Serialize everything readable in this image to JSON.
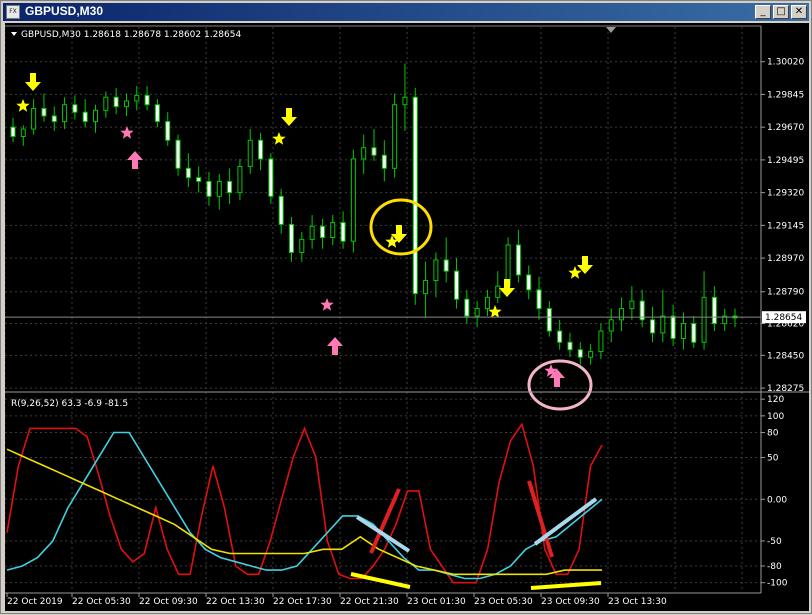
{
  "window": {
    "title": "GBPUSD,M30",
    "icon_label": "FX",
    "buttons": {
      "minimize": "_",
      "maximize": "□",
      "close": "✕"
    }
  },
  "colors": {
    "background": "#000000",
    "grid": "#3c3c3c",
    "bull_candle": "#000000",
    "bear_candle": "#ffffff",
    "candle_outline": "#00c800",
    "rsi_line": "#e01010",
    "ma_fast_line": "#40d0e0",
    "ma_slow_line": "#f0e000",
    "arrow_down": "#ffff00",
    "arrow_up": "#ff7ab5",
    "star_yellow": "#ffff00",
    "star_pink": "#ff7ab5",
    "axis_text": "#ffffff",
    "annotation_circle_yellow": "#ffdd00",
    "annotation_circle_pink": "#f5b5c8",
    "annotation_red": "#e02020",
    "annotation_blue": "#a8d8ee",
    "annotation_yellow": "#ffff00"
  },
  "chart": {
    "symbol_line": "GBPUSD,M30  1.28618 1.28678 1.28602 1.28654",
    "current_price": "1.28654",
    "price_labels": [
      "1.30020",
      "1.29845",
      "1.29670",
      "1.29495",
      "1.29320",
      "1.29145",
      "1.28970",
      "1.28790",
      "1.28620",
      "1.28450",
      "1.28275"
    ],
    "osc_header": "R(9,26,52) 63.3 -6.9 -81.5",
    "osc_labels": [
      "120",
      "100",
      "80",
      "50",
      "0.00",
      "-50",
      "-80",
      "-100"
    ],
    "time_labels": [
      "22 Oct 2019",
      "22 Oct 05:30",
      "22 Oct 09:30",
      "22 Oct 13:30",
      "22 Oct 17:30",
      "22 Oct 21:30",
      "23 Oct 01:30",
      "23 Oct 05:30",
      "23 Oct 09:30",
      "23 Oct 13:30"
    ]
  },
  "chart_data": [
    {
      "type": "candlestick",
      "title": "GBPUSD,M30  1.28618 1.28678 1.28602 1.28654",
      "ylim": [
        1.2827,
        1.3012
      ],
      "candles": [
        {
          "o": 1.2967,
          "h": 1.2972,
          "l": 1.2959,
          "c": 1.2962
        },
        {
          "o": 1.2962,
          "h": 1.2968,
          "l": 1.2957,
          "c": 1.2966
        },
        {
          "o": 1.2966,
          "h": 1.2982,
          "l": 1.2963,
          "c": 1.2977
        },
        {
          "o": 1.2977,
          "h": 1.2985,
          "l": 1.297,
          "c": 1.2973
        },
        {
          "o": 1.2973,
          "h": 1.2978,
          "l": 1.2965,
          "c": 1.297
        },
        {
          "o": 1.297,
          "h": 1.2983,
          "l": 1.2966,
          "c": 1.2979
        },
        {
          "o": 1.2979,
          "h": 1.2984,
          "l": 1.2971,
          "c": 1.2975
        },
        {
          "o": 1.2975,
          "h": 1.2982,
          "l": 1.2967,
          "c": 1.297
        },
        {
          "o": 1.297,
          "h": 1.2979,
          "l": 1.2964,
          "c": 1.2976
        },
        {
          "o": 1.2976,
          "h": 1.2986,
          "l": 1.2972,
          "c": 1.2983
        },
        {
          "o": 1.2983,
          "h": 1.2988,
          "l": 1.2974,
          "c": 1.2978
        },
        {
          "o": 1.2978,
          "h": 1.2985,
          "l": 1.2973,
          "c": 1.2981
        },
        {
          "o": 1.2981,
          "h": 1.2989,
          "l": 1.2976,
          "c": 1.2984
        },
        {
          "o": 1.2984,
          "h": 1.2989,
          "l": 1.2976,
          "c": 1.2979
        },
        {
          "o": 1.2979,
          "h": 1.2982,
          "l": 1.2967,
          "c": 1.297
        },
        {
          "o": 1.297,
          "h": 1.2975,
          "l": 1.2957,
          "c": 1.296
        },
        {
          "o": 1.296,
          "h": 1.2963,
          "l": 1.2941,
          "c": 1.2945
        },
        {
          "o": 1.2945,
          "h": 1.2953,
          "l": 1.2935,
          "c": 1.294
        },
        {
          "o": 1.294,
          "h": 1.2946,
          "l": 1.2932,
          "c": 1.2938
        },
        {
          "o": 1.2938,
          "h": 1.2943,
          "l": 1.2925,
          "c": 1.293
        },
        {
          "o": 1.293,
          "h": 1.2942,
          "l": 1.2923,
          "c": 1.2938
        },
        {
          "o": 1.2938,
          "h": 1.2945,
          "l": 1.2926,
          "c": 1.2932
        },
        {
          "o": 1.2932,
          "h": 1.295,
          "l": 1.2928,
          "c": 1.2946
        },
        {
          "o": 1.2946,
          "h": 1.2966,
          "l": 1.2942,
          "c": 1.296
        },
        {
          "o": 1.296,
          "h": 1.2964,
          "l": 1.2944,
          "c": 1.295
        },
        {
          "o": 1.295,
          "h": 1.2953,
          "l": 1.2926,
          "c": 1.293
        },
        {
          "o": 1.293,
          "h": 1.2934,
          "l": 1.291,
          "c": 1.2915
        },
        {
          "o": 1.2915,
          "h": 1.2919,
          "l": 1.2895,
          "c": 1.29
        },
        {
          "o": 1.29,
          "h": 1.2911,
          "l": 1.2895,
          "c": 1.2907
        },
        {
          "o": 1.2907,
          "h": 1.292,
          "l": 1.2902,
          "c": 1.2914
        },
        {
          "o": 1.2914,
          "h": 1.2918,
          "l": 1.2902,
          "c": 1.2908
        },
        {
          "o": 1.2908,
          "h": 1.292,
          "l": 1.2904,
          "c": 1.2916
        },
        {
          "o": 1.2916,
          "h": 1.2922,
          "l": 1.2902,
          "c": 1.2906
        },
        {
          "o": 1.2906,
          "h": 1.2955,
          "l": 1.29,
          "c": 1.295
        },
        {
          "o": 1.295,
          "h": 1.2963,
          "l": 1.2942,
          "c": 1.2956
        },
        {
          "o": 1.2956,
          "h": 1.2966,
          "l": 1.2949,
          "c": 1.2952
        },
        {
          "o": 1.2952,
          "h": 1.296,
          "l": 1.2938,
          "c": 1.2945
        },
        {
          "o": 1.2945,
          "h": 1.2985,
          "l": 1.294,
          "c": 1.2979
        },
        {
          "o": 1.2979,
          "h": 1.3001,
          "l": 1.2965,
          "c": 1.2983
        },
        {
          "o": 1.2983,
          "h": 1.2988,
          "l": 1.2872,
          "c": 1.2878
        },
        {
          "o": 1.2878,
          "h": 1.2895,
          "l": 1.2865,
          "c": 1.2885
        },
        {
          "o": 1.2885,
          "h": 1.29,
          "l": 1.2876,
          "c": 1.2896
        },
        {
          "o": 1.2896,
          "h": 1.2908,
          "l": 1.2884,
          "c": 1.289
        },
        {
          "o": 1.289,
          "h": 1.2897,
          "l": 1.287,
          "c": 1.2875
        },
        {
          "o": 1.2875,
          "h": 1.288,
          "l": 1.2862,
          "c": 1.2866
        },
        {
          "o": 1.2866,
          "h": 1.2874,
          "l": 1.286,
          "c": 1.287
        },
        {
          "o": 1.287,
          "h": 1.288,
          "l": 1.2866,
          "c": 1.2876
        },
        {
          "o": 1.2876,
          "h": 1.289,
          "l": 1.2873,
          "c": 1.2882
        },
        {
          "o": 1.2882,
          "h": 1.2908,
          "l": 1.2879,
          "c": 1.2904
        },
        {
          "o": 1.2904,
          "h": 1.2912,
          "l": 1.2884,
          "c": 1.2888
        },
        {
          "o": 1.2888,
          "h": 1.2893,
          "l": 1.2875,
          "c": 1.288
        },
        {
          "o": 1.288,
          "h": 1.2887,
          "l": 1.2864,
          "c": 1.287
        },
        {
          "o": 1.287,
          "h": 1.2874,
          "l": 1.2855,
          "c": 1.2858
        },
        {
          "o": 1.2858,
          "h": 1.2864,
          "l": 1.2848,
          "c": 1.2852
        },
        {
          "o": 1.2852,
          "h": 1.2857,
          "l": 1.2844,
          "c": 1.2848
        },
        {
          "o": 1.2848,
          "h": 1.2852,
          "l": 1.284,
          "c": 1.2844
        },
        {
          "o": 1.2844,
          "h": 1.2851,
          "l": 1.284,
          "c": 1.2847
        },
        {
          "o": 1.2847,
          "h": 1.2862,
          "l": 1.2843,
          "c": 1.2858
        },
        {
          "o": 1.2858,
          "h": 1.287,
          "l": 1.2852,
          "c": 1.2864
        },
        {
          "o": 1.2864,
          "h": 1.2876,
          "l": 1.2858,
          "c": 1.287
        },
        {
          "o": 1.287,
          "h": 1.2882,
          "l": 1.2864,
          "c": 1.2874
        },
        {
          "o": 1.2874,
          "h": 1.288,
          "l": 1.286,
          "c": 1.2864
        },
        {
          "o": 1.2864,
          "h": 1.2871,
          "l": 1.2852,
          "c": 1.2857
        },
        {
          "o": 1.2857,
          "h": 1.288,
          "l": 1.2852,
          "c": 1.2866
        },
        {
          "o": 1.2866,
          "h": 1.2872,
          "l": 1.285,
          "c": 1.2854
        },
        {
          "o": 1.2854,
          "h": 1.2868,
          "l": 1.2848,
          "c": 1.2862
        },
        {
          "o": 1.2862,
          "h": 1.2866,
          "l": 1.2849,
          "c": 1.2852
        },
        {
          "o": 1.2852,
          "h": 1.289,
          "l": 1.2848,
          "c": 1.2876
        },
        {
          "o": 1.2876,
          "h": 1.2882,
          "l": 1.2858,
          "c": 1.2862
        },
        {
          "o": 1.2862,
          "h": 1.287,
          "l": 1.2858,
          "c": 1.2866
        },
        {
          "o": 1.2866,
          "h": 1.287,
          "l": 1.286,
          "c": 1.2865
        }
      ],
      "indicator": {
        "name": "R(9,26,52) 63.3 -6.9 -81.5",
        "ylim": [
          -110,
          125
        ],
        "series": [
          {
            "color": "#e01010",
            "values": [
              -40,
              40,
              85,
              85,
              85,
              85,
              85,
              75,
              30,
              -20,
              -60,
              -75,
              -65,
              -10,
              -60,
              -90,
              -90,
              -20,
              40,
              -10,
              -80,
              -90,
              -90,
              -50,
              0,
              50,
              85,
              50,
              -50,
              -90,
              -95,
              -95,
              -80,
              -60,
              -30,
              10,
              10,
              -60,
              -80,
              -100,
              -100,
              -100,
              -60,
              20,
              70,
              90,
              40,
              -60,
              -90,
              -90,
              -60,
              40,
              65
            ]
          },
          {
            "color": "#40d0e0",
            "values": [
              -85,
              -80,
              -70,
              -50,
              -10,
              20,
              50,
              80,
              80,
              50,
              20,
              -10,
              -40,
              -60,
              -70,
              -75,
              -80,
              -85,
              -85,
              -80,
              -60,
              -40,
              -20,
              -20,
              -30,
              -50,
              -70,
              -85,
              -85,
              -90,
              -95,
              -95,
              -90,
              -80,
              -60,
              -50,
              -45,
              -30,
              -15,
              0
            ]
          },
          {
            "color": "#f0e000",
            "values": [
              60,
              50,
              40,
              30,
              20,
              10,
              0,
              -10,
              -20,
              -30,
              -45,
              -60,
              -65,
              -65,
              -65,
              -65,
              -65,
              -60,
              -60,
              -45,
              -60,
              -70,
              -80,
              -85,
              -90,
              -90,
              -90,
              -90,
              -90,
              -90,
              -85,
              -85,
              -85
            ]
          }
        ]
      }
    }
  ]
}
